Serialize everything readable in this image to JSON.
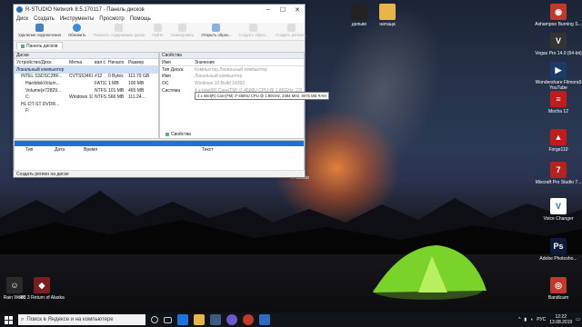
{
  "desktop": {
    "icons_left": [
      {
        "label": "Rain World",
        "color": "#2a2a2a"
      },
      {
        "label": "RC 3 Return of Alaska",
        "color": "#7a1f1f"
      }
    ],
    "icons_top": [
      {
        "label": "дельво",
        "color": "#222"
      },
      {
        "label": "натаща",
        "color": "#e8b54a"
      }
    ],
    "icons_right": [
      {
        "label": "Ashampoo Burning S...",
        "color": "#c0392b",
        "glyph": "◉"
      },
      {
        "label": "Vegas Pro 14.0 (64-bit)",
        "color": "#333",
        "glyph": "V"
      },
      {
        "label": "Wondershare Filmora9 YouTube",
        "color": "#1a3b6a",
        "glyph": "▶"
      },
      {
        "label": "Mocha 12",
        "color": "#c21b1b",
        "glyph": "≡"
      },
      {
        "label": "Forge110",
        "color": "#c21b1b",
        "glyph": "▲"
      },
      {
        "label": "Mixcraft Pro Studio 7...",
        "color": "#b5241c",
        "glyph": "7"
      },
      {
        "label": "Voice Changer",
        "color": "#ffffff",
        "glyph": "V"
      },
      {
        "label": "Adobe Photosho...",
        "color": "#0b1c3a",
        "glyph": "Ps"
      },
      {
        "label": "Bandicam",
        "color": "#c0392b",
        "glyph": "◎"
      }
    ],
    "r_studio_label": "R-Studio"
  },
  "window": {
    "title": "R-STUDIO Network 8.5.170117 - Панель дисков",
    "menu": [
      "Диск",
      "Создать",
      "Инструменты",
      "Просмотр",
      "Помощь"
    ],
    "toolbar": [
      {
        "label": "Удаление подключения",
        "disabled": false
      },
      {
        "label": "Обновить",
        "disabled": false
      },
      {
        "label": "Показать содержимое диска",
        "disabled": true
      },
      {
        "label": "Найти",
        "disabled": true
      },
      {
        "label": "Сканировать",
        "disabled": true
      },
      {
        "label": "Открыть образ...",
        "disabled": false
      },
      {
        "label": "Создать образ...",
        "disabled": true
      },
      {
        "label": "Создать регион...",
        "disabled": true
      }
    ],
    "tab_label": "Панель дисков",
    "disks_pane": {
      "header": "Диски",
      "columns": [
        "Устройство/Диск",
        "Метка",
        "вая с",
        "Начало",
        "Размер"
      ],
      "rows": [
        {
          "device": "Локальный компьютер",
          "label": "",
          "fs": "",
          "start": "",
          "size": "",
          "selected": true
        },
        {
          "device": "INTEL SSDSC2BF...",
          "label": "CVTS5346I...",
          "fs": "#12",
          "start": "0 Bytes",
          "size": "111.79 GB",
          "selected": false
        },
        {
          "device": "HarddiskVolum...",
          "label": "",
          "fs": "FAT32",
          "start": "1 MB",
          "size": "100 MB",
          "selected": false
        },
        {
          "device": "Volume{e72829...",
          "label": "",
          "fs": "NTFS",
          "start": "101 MB",
          "size": "465 MB",
          "selected": false
        },
        {
          "device": "C:",
          "label": "Windows 10",
          "fs": "NTFS",
          "start": "566 MB",
          "size": "111.24...",
          "selected": false
        },
        {
          "device": "HL-DT-ST DVDR...",
          "label": "",
          "fs": "",
          "start": "",
          "size": "",
          "selected": false
        },
        {
          "device": "F:",
          "label": "",
          "fs": "",
          "start": "",
          "size": "",
          "selected": false
        }
      ]
    },
    "props_pane": {
      "header": "Свойства",
      "columns": [
        "Имя",
        "Значение"
      ],
      "rows": [
        {
          "name": "Тип Диска",
          "value": "Компьютер,Локальный компьютер"
        },
        {
          "name": "Имя",
          "value": "Локальный компьютер"
        },
        {
          "name": "ОС",
          "value": "Windows 10 Build 14393"
        },
        {
          "name": "Система",
          "value": "4 x Intel(R) Core(TM) i7-4500U CPU @ 1.80GHz, 239..."
        }
      ],
      "tooltip": "4 x Intel(R) Core(TM) i7-4500U CPU @ 1.80GHz, 2394 MHz, 8075 MB RAM",
      "bottom_tab": "Свойства"
    },
    "log_pane": {
      "columns": [
        "Тип",
        "Дата",
        "Время",
        "Текст"
      ]
    },
    "status": "Создать регион на диске"
  },
  "taskbar": {
    "search_placeholder": "Поиск в Яндексе и на компьютере",
    "lang": "РУС",
    "time": "12:22",
    "date": "13.08.2019"
  }
}
